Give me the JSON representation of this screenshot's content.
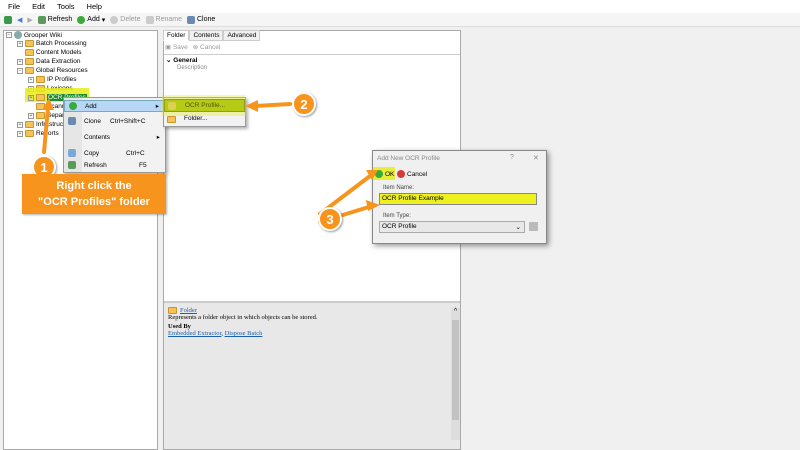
{
  "menu": [
    "File",
    "Edit",
    "Tools",
    "Help"
  ],
  "toolbar": {
    "refresh": "Refresh",
    "add": "Add",
    "delete": "Delete",
    "rename": "Rename",
    "clone": "Clone"
  },
  "tree": {
    "root": "Grooper Wiki",
    "items": [
      "Batch Processing",
      "Content Models",
      "Data Extraction",
      "Global Resources",
      "IP Profiles",
      "Lexicons",
      "OCR Profiles",
      "Scanner Profiles",
      "Separation Profiles",
      "Infrastructure",
      "Reports"
    ]
  },
  "context_menu": {
    "add": "Add",
    "clone": "Clone",
    "clone_shortcut": "Ctrl+Shift+C",
    "contents": "Contents",
    "copy": "Copy",
    "copy_shortcut": "Ctrl+C",
    "refresh": "Refresh",
    "refresh_shortcut": "F5"
  },
  "submenu": {
    "ocr_profile": "OCR Profile...",
    "folder": "Folder..."
  },
  "tabs": [
    "Folder",
    "Contents",
    "Advanced"
  ],
  "editor": {
    "save": "Save",
    "cancel": "Cancel",
    "section": "General",
    "property": "Description"
  },
  "help": {
    "title": "Folder",
    "description": "Represents a folder object in which objects can be stored.",
    "used_by": "Used By",
    "link1": "Embedded Extractor",
    "link2": "Dispose Batch"
  },
  "dialog": {
    "title": "Add New OCR Profile",
    "help": "?",
    "close": "✕",
    "ok": "OK",
    "cancel": "Cancel",
    "name_label": "Item Name:",
    "name_value": "OCR Profile Example",
    "type_label": "Item Type:",
    "type_value": "OCR Profile"
  },
  "callouts": {
    "one": "1",
    "two": "2",
    "three": "3",
    "text_line1": "Right click the",
    "text_line2": "\"OCR Profiles\" folder"
  },
  "colors": {
    "accent": "#f7941d",
    "highlight": "#e6ec1a"
  }
}
